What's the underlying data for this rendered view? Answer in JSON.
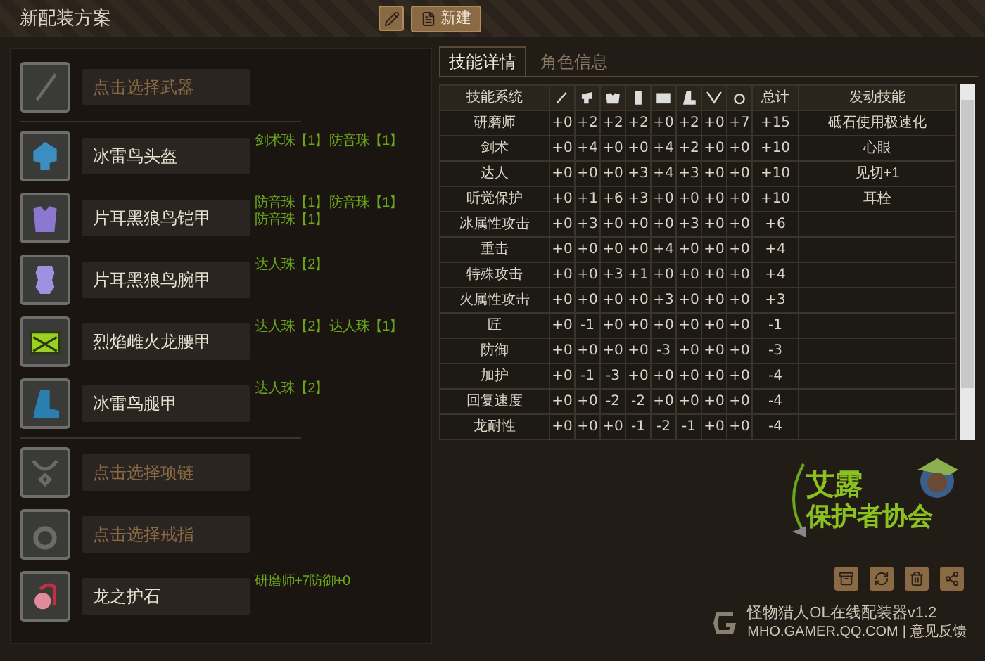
{
  "header": {
    "title": "新配装方案",
    "new_button": "新建"
  },
  "slots": [
    {
      "kind": "empty",
      "placeholder": "点击选择武器"
    },
    {
      "kind": "filled",
      "name": "冰雷鸟头盔",
      "jewels": [
        "剑术珠【1】",
        "防音珠【1】"
      ]
    },
    {
      "kind": "filled",
      "name": "片耳黑狼鸟铠甲",
      "jewels": [
        "防音珠【1】",
        "防音珠【1】",
        "防音珠【1】"
      ]
    },
    {
      "kind": "filled",
      "name": "片耳黑狼鸟腕甲",
      "jewels": [
        "达人珠【2】"
      ]
    },
    {
      "kind": "filled",
      "name": "烈焰雌火龙腰甲",
      "jewels": [
        "达人珠【2】",
        "达人珠【1】"
      ]
    },
    {
      "kind": "filled",
      "name": "冰雷鸟腿甲",
      "jewels": [
        "达人珠【2】"
      ]
    },
    {
      "kind": "empty",
      "placeholder": "点击选择项链"
    },
    {
      "kind": "empty",
      "placeholder": "点击选择戒指"
    },
    {
      "kind": "filled",
      "name": "龙之护石",
      "jewels": [
        "研磨师+7防御+0"
      ]
    }
  ],
  "tabs": [
    {
      "label": "技能详情",
      "selected": true
    },
    {
      "label": "角色信息",
      "selected": false
    }
  ],
  "table": {
    "columns": [
      "技能系统",
      "总计",
      "发动技能"
    ],
    "rows": [
      {
        "skill": "研磨师",
        "values": [
          "+0",
          "+2",
          "+2",
          "+2",
          "+0",
          "+2",
          "+0",
          "+7"
        ],
        "total": "+15",
        "active": "砥石使用极速化"
      },
      {
        "skill": "剑术",
        "values": [
          "+0",
          "+4",
          "+0",
          "+0",
          "+4",
          "+2",
          "+0",
          "+0"
        ],
        "total": "+10",
        "active": "心眼"
      },
      {
        "skill": "达人",
        "values": [
          "+0",
          "+0",
          "+0",
          "+3",
          "+4",
          "+3",
          "+0",
          "+0"
        ],
        "total": "+10",
        "active": "见切+1"
      },
      {
        "skill": "听觉保护",
        "values": [
          "+0",
          "+1",
          "+6",
          "+3",
          "+0",
          "+0",
          "+0",
          "+0"
        ],
        "total": "+10",
        "active": "耳栓"
      },
      {
        "skill": "冰属性攻击",
        "values": [
          "+0",
          "+3",
          "+0",
          "+0",
          "+0",
          "+3",
          "+0",
          "+0"
        ],
        "total": "+6"
      },
      {
        "skill": "重击",
        "values": [
          "+0",
          "+0",
          "+0",
          "+0",
          "+4",
          "+0",
          "+0",
          "+0"
        ],
        "total": "+4"
      },
      {
        "skill": "特殊攻击",
        "values": [
          "+0",
          "+0",
          "+3",
          "+1",
          "+0",
          "+0",
          "+0",
          "+0"
        ],
        "total": "+4"
      },
      {
        "skill": "火属性攻击",
        "values": [
          "+0",
          "+0",
          "+0",
          "+0",
          "+3",
          "+0",
          "+0",
          "+0"
        ],
        "total": "+3"
      },
      {
        "skill": "匠",
        "values": [
          "+0",
          "-1",
          "+0",
          "+0",
          "+0",
          "+0",
          "+0",
          "+0"
        ],
        "total": "-1"
      },
      {
        "skill": "防御",
        "values": [
          "+0",
          "+0",
          "+0",
          "+0",
          "-3",
          "+0",
          "+0",
          "+0"
        ],
        "total": "-3"
      },
      {
        "skill": "加护",
        "values": [
          "+0",
          "-1",
          "-3",
          "+0",
          "+0",
          "+0",
          "+0",
          "+0"
        ],
        "total": "-4"
      },
      {
        "skill": "回复速度",
        "values": [
          "+0",
          "+0",
          "-2",
          "-2",
          "+0",
          "+0",
          "+0",
          "+0"
        ],
        "total": "-4"
      },
      {
        "skill": "龙耐性",
        "values": [
          "+0",
          "+0",
          "+0",
          "-1",
          "-2",
          "-1",
          "+0",
          "+0"
        ],
        "total": "-4"
      }
    ]
  },
  "logo": {
    "line_1": "艾露",
    "line_2": "保护者协会"
  },
  "footer": {
    "title": "怪物猎人OL在线配装器v1.2",
    "site": "MHO.GAMER.QQ.COM",
    "separator": "|",
    "feedback": "意见反馈"
  }
}
